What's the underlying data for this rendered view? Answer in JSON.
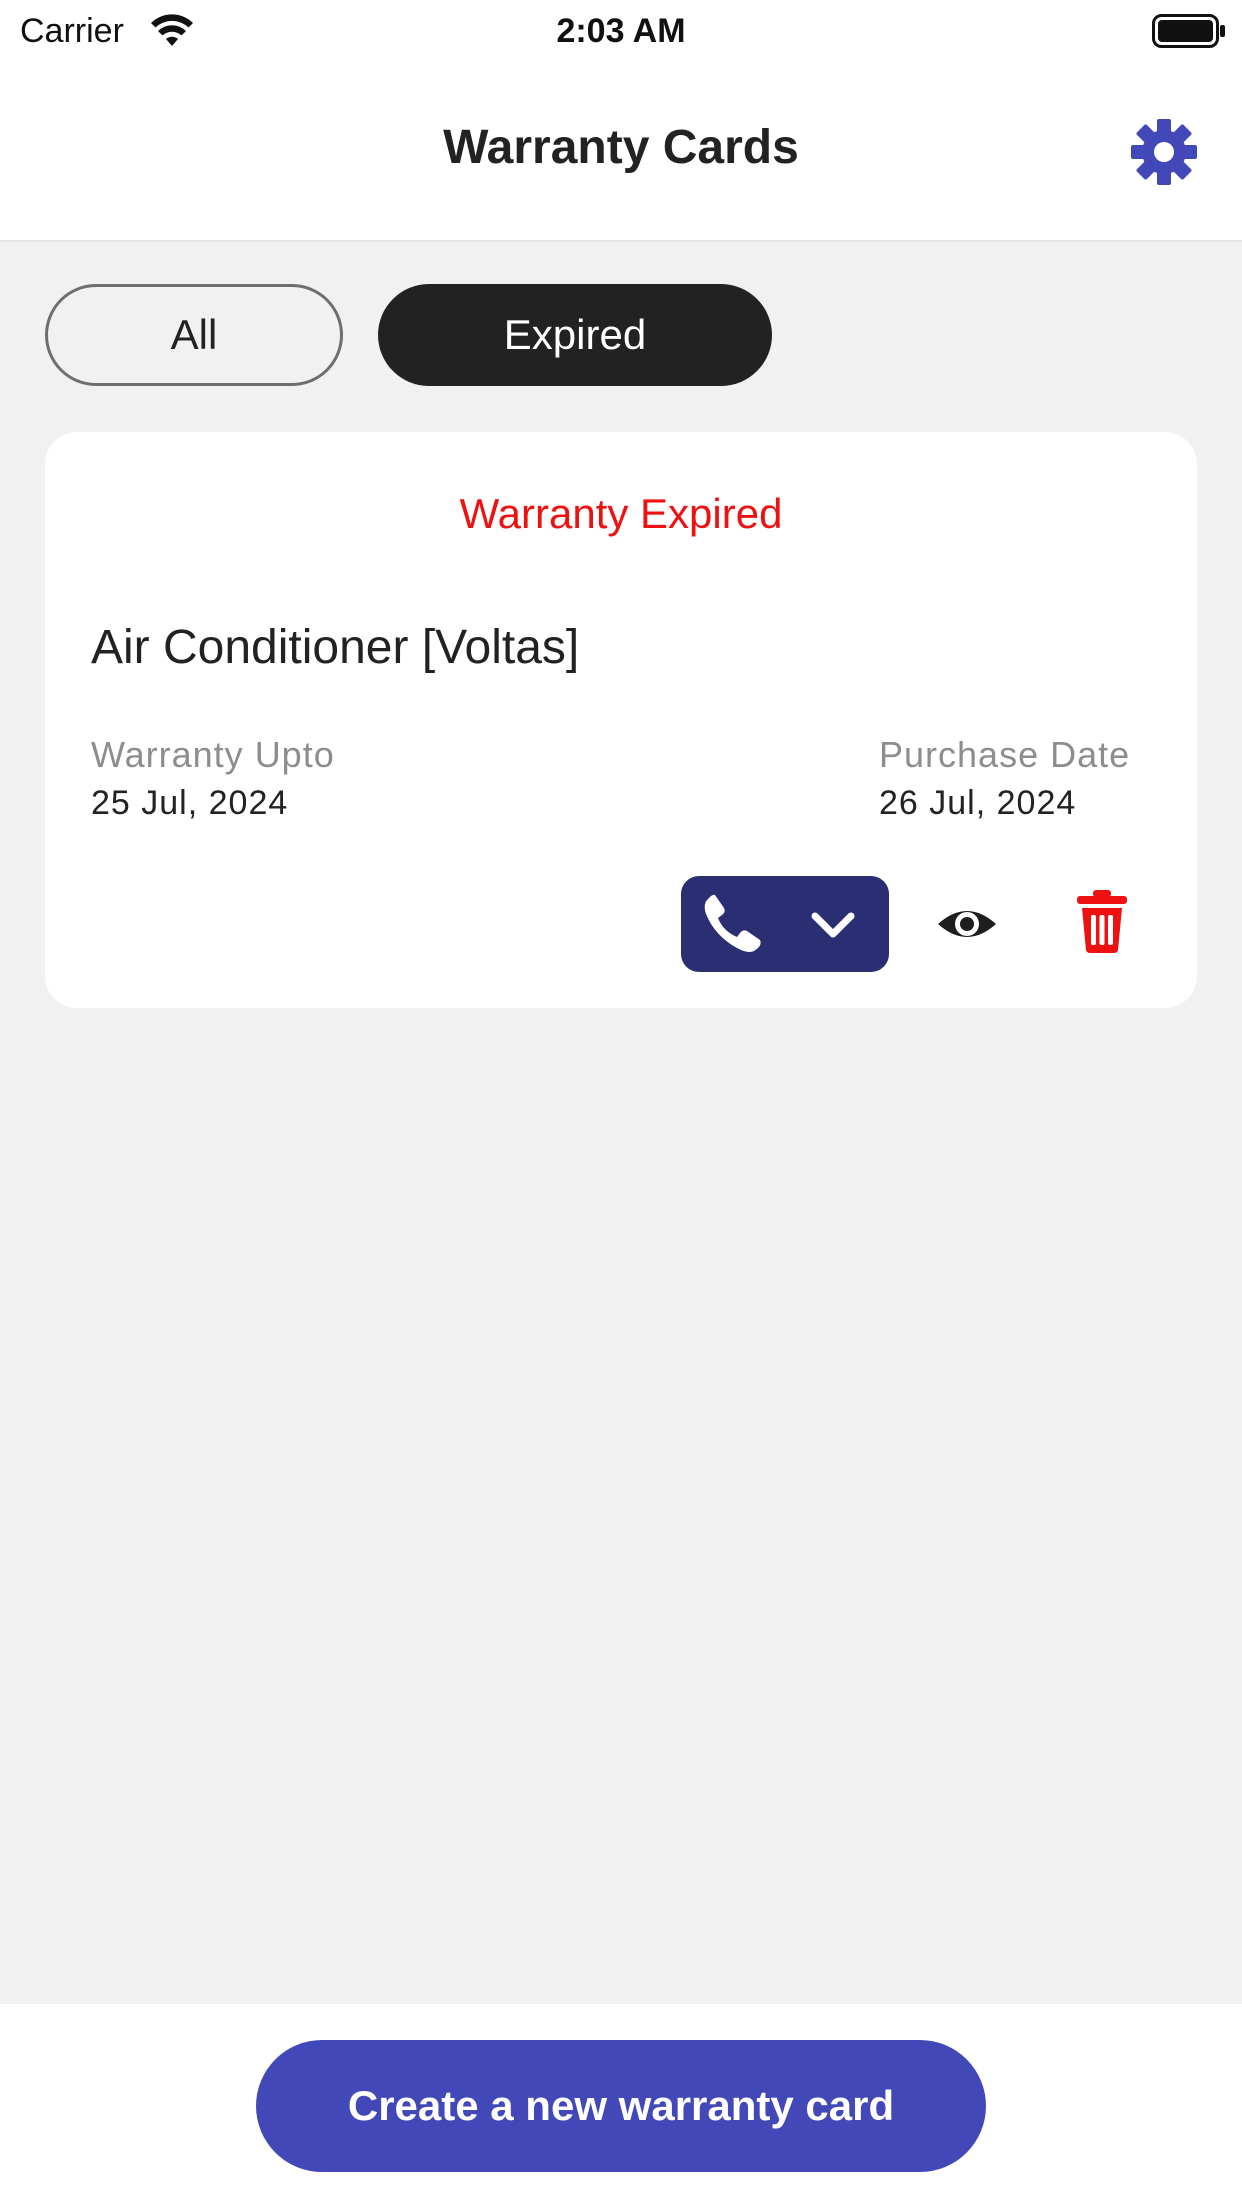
{
  "status_bar": {
    "carrier": "Carrier",
    "time": "2:03 AM",
    "icons": [
      "wifi-icon",
      "battery-icon"
    ]
  },
  "nav": {
    "title": "Warranty Cards",
    "settings_icon": "gear-icon"
  },
  "filters": {
    "all_label": "All",
    "expired_label": "Expired",
    "selected": "Expired"
  },
  "cards": [
    {
      "status": "Warranty Expired",
      "product": "Air Conditioner [Voltas]",
      "warranty_label": "Warranty Upto",
      "warranty_value": "25 Jul, 2024",
      "purchase_label": "Purchase Date",
      "purchase_value": "26 Jul, 2024",
      "actions": [
        "phone-icon",
        "chevron-down-icon",
        "eye-icon",
        "trash-icon"
      ]
    }
  ],
  "footer": {
    "create_label": "Create a new warranty card"
  },
  "colors": {
    "accent": "#4348b8",
    "call_button": "#2a2f73",
    "expired_text": "#ee1111",
    "delete": "#ee1111",
    "selected_pill": "#222222"
  }
}
